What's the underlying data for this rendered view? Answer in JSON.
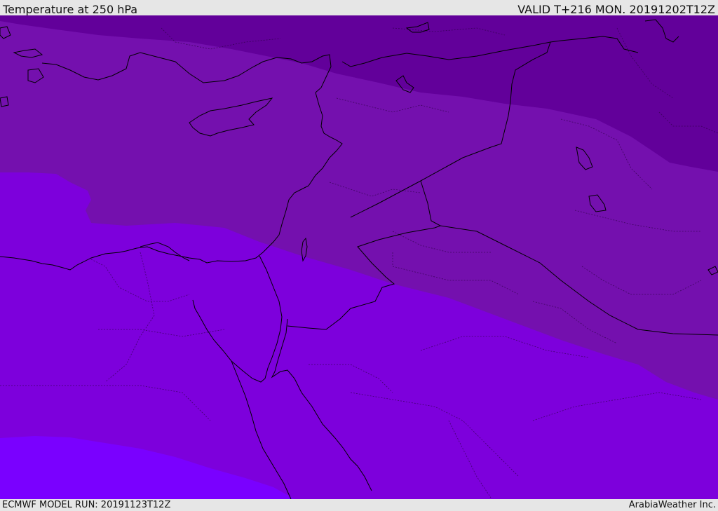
{
  "header": {
    "title": "Temperature at 250 hPa",
    "valid": "VALID T+216 MON. 20191202T12Z"
  },
  "footer": {
    "model_run": "ECMWF MODEL RUN: 20191123T12Z",
    "credit": "ArabiaWeather Inc."
  },
  "colors": {
    "band_darkest": "#62009a",
    "band_dark": "#7410ae",
    "band_mid": "#7d00dc",
    "band_bright": "#7a00ff",
    "coastline": "#000000"
  },
  "map": {
    "region": "Eastern Mediterranean / Middle East",
    "field": "temperature at 250 hPa",
    "bands": [
      "darkest",
      "dark",
      "mid",
      "bright"
    ]
  }
}
